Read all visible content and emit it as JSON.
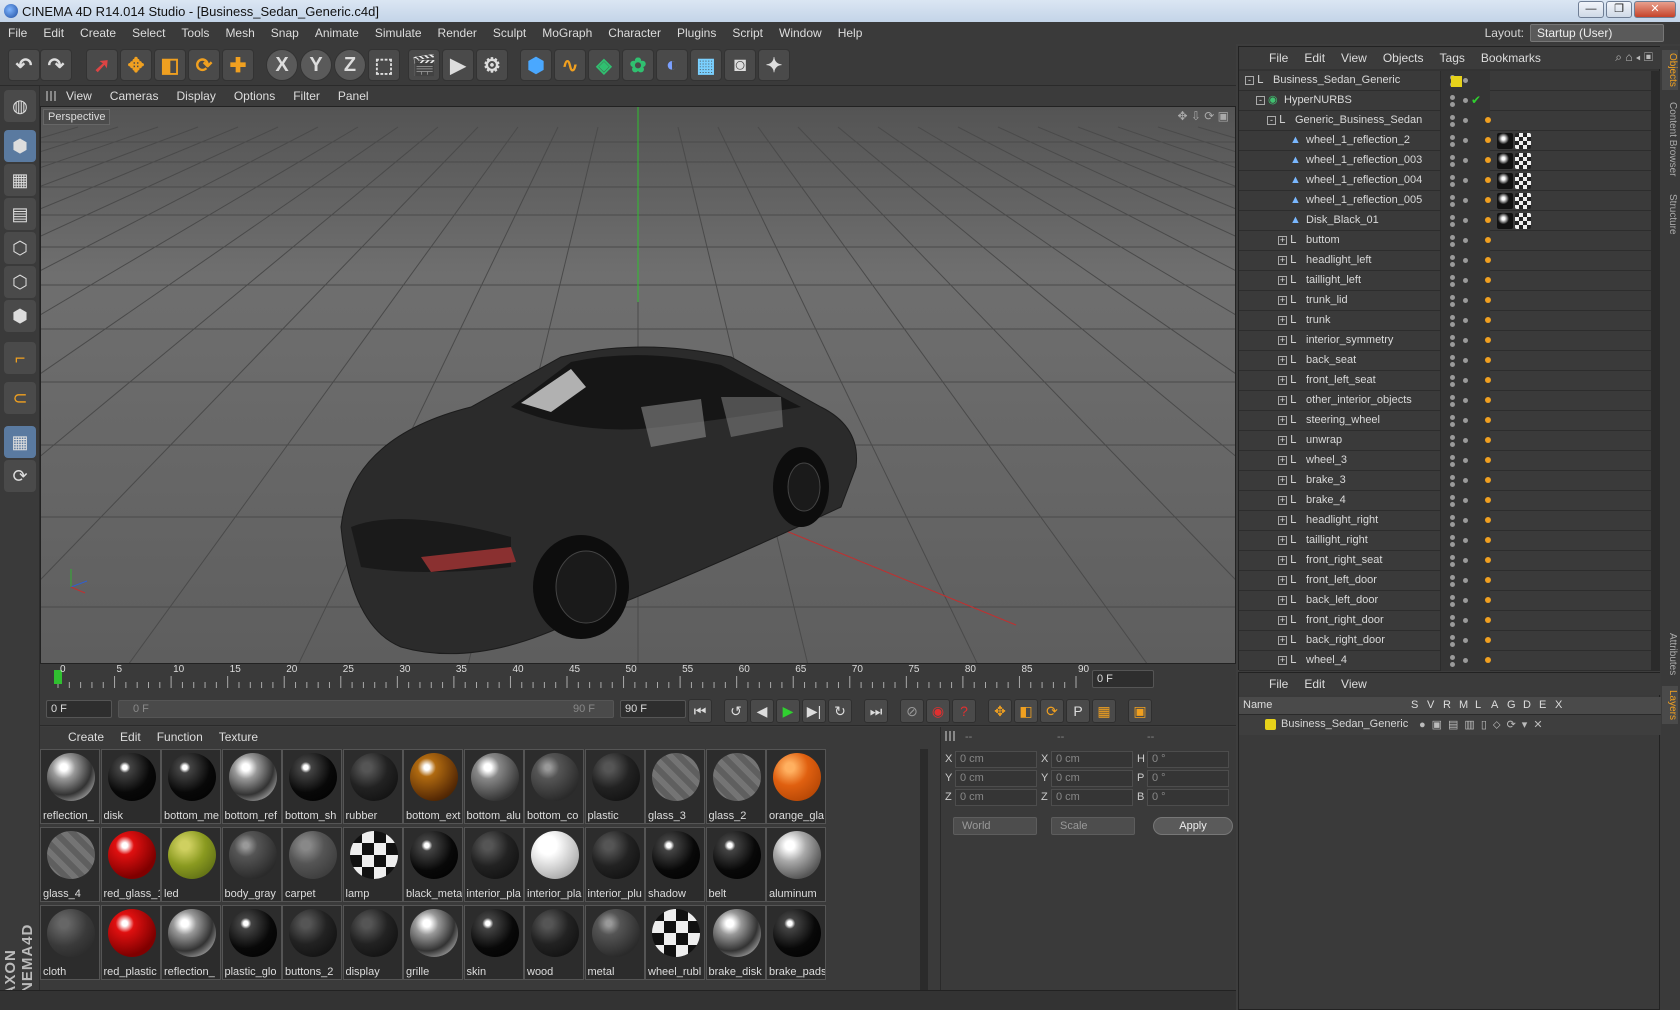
{
  "window": {
    "title": "CINEMA 4D R14.014 Studio - [Business_Sedan_Generic.c4d]",
    "minimize": "—",
    "maximize": "❐",
    "close": "✕"
  },
  "menu": [
    "File",
    "Edit",
    "Create",
    "Select",
    "Tools",
    "Mesh",
    "Snap",
    "Animate",
    "Simulate",
    "Render",
    "Sculpt",
    "MoGraph",
    "Character",
    "Plugins",
    "Script",
    "Window",
    "Help"
  ],
  "layout": {
    "label": "Layout:",
    "value": "Startup (User)"
  },
  "toolbar_icons": [
    "undo-icon",
    "redo-icon",
    "live-selection-icon",
    "move-icon",
    "scale-icon",
    "rotate-icon",
    "add-icon",
    "x-axis-icon",
    "y-axis-icon",
    "z-axis-icon",
    "coordinate-system-icon",
    "render-view-icon",
    "render-picture-viewer-icon",
    "render-settings-icon",
    "cube-icon",
    "spline-pen-icon",
    "nurbs-icon",
    "array-icon",
    "deformer-icon",
    "floor-icon",
    "camera-icon",
    "light-icon"
  ],
  "viewport": {
    "menu": [
      "View",
      "Cameras",
      "Display",
      "Options",
      "Filter",
      "Panel"
    ],
    "label": "Perspective"
  },
  "timeline": {
    "ticks": [
      "0",
      "5",
      "10",
      "15",
      "20",
      "25",
      "30",
      "35",
      "40",
      "45",
      "50",
      "55",
      "60",
      "65",
      "70",
      "75",
      "80",
      "85",
      "90"
    ],
    "current_frame": "0 F",
    "start_field": "0 F",
    "range_start": "0 F",
    "range_end": "90 F",
    "end_field": "90 F"
  },
  "materials": {
    "menu": [
      "Create",
      "Edit",
      "Function",
      "Texture"
    ],
    "items": [
      {
        "name": "reflection_",
        "style": "chrome"
      },
      {
        "name": "disk",
        "style": "black"
      },
      {
        "name": "bottom_me",
        "style": "black"
      },
      {
        "name": "bottom_ref",
        "style": "chrome"
      },
      {
        "name": "bottom_sh",
        "style": "black"
      },
      {
        "name": "rubber",
        "style": "dark"
      },
      {
        "name": "bottom_ext",
        "style": "bronze"
      },
      {
        "name": "bottom_alu",
        "style": "gray"
      },
      {
        "name": "bottom_co",
        "style": "darkgray"
      },
      {
        "name": "plastic",
        "style": "dark"
      },
      {
        "name": "glass_3",
        "style": "glass"
      },
      {
        "name": "glass_2",
        "style": "glass"
      },
      {
        "name": "orange_gla",
        "style": "orange"
      },
      {
        "name": "glass_4",
        "style": "glass"
      },
      {
        "name": "red_glass_1",
        "style": "red"
      },
      {
        "name": "led",
        "style": "olive"
      },
      {
        "name": "body_gray",
        "style": "darkgray"
      },
      {
        "name": "carpet",
        "style": "midgray"
      },
      {
        "name": "lamp",
        "style": "checker"
      },
      {
        "name": "black_meta",
        "style": "black"
      },
      {
        "name": "interior_pla",
        "style": "dark"
      },
      {
        "name": "interior_pla",
        "style": "white"
      },
      {
        "name": "interior_plu",
        "style": "dark"
      },
      {
        "name": "shadow",
        "style": "black"
      },
      {
        "name": "belt",
        "style": "black"
      },
      {
        "name": "aluminum",
        "style": "silver"
      },
      {
        "name": "cloth",
        "style": "cloth"
      },
      {
        "name": "red_plastic",
        "style": "red"
      },
      {
        "name": "reflection_",
        "style": "chrome"
      },
      {
        "name": "plastic_glo",
        "style": "black"
      },
      {
        "name": "buttons_2",
        "style": "dark"
      },
      {
        "name": "display",
        "style": "dark"
      },
      {
        "name": "grille",
        "style": "chrome"
      },
      {
        "name": "skin",
        "style": "black"
      },
      {
        "name": "wood",
        "style": "dark"
      },
      {
        "name": "metal",
        "style": "darkgray"
      },
      {
        "name": "wheel_rubl",
        "style": "checker"
      },
      {
        "name": "brake_disk",
        "style": "chrome"
      },
      {
        "name": "brake_pads",
        "style": "black"
      }
    ]
  },
  "coords": {
    "headers": [
      "--",
      "--",
      "--"
    ],
    "rows": [
      {
        "a": "X",
        "av": "0 cm",
        "b": "X",
        "bv": "0 cm",
        "c": "H",
        "cv": "0 °"
      },
      {
        "a": "Y",
        "av": "0 cm",
        "b": "Y",
        "bv": "0 cm",
        "c": "P",
        "cv": "0 °"
      },
      {
        "a": "Z",
        "av": "0 cm",
        "b": "Z",
        "bv": "0 cm",
        "c": "B",
        "cv": "0 °"
      }
    ],
    "mode": "World",
    "size_mode": "Scale",
    "apply": "Apply"
  },
  "objects": {
    "menu": [
      "File",
      "Edit",
      "View",
      "Objects",
      "Tags",
      "Bookmarks"
    ],
    "rows": [
      {
        "name": "Business_Sedan_Generic",
        "depth": 0,
        "icon": "null-icon",
        "expand": "-",
        "tags": []
      },
      {
        "name": "HyperNURBS",
        "depth": 1,
        "icon": "hypernurbs-icon",
        "expand": "-",
        "tags": []
      },
      {
        "name": "Generic_Business_Sedan",
        "depth": 2,
        "icon": "null-icon",
        "expand": "-",
        "tags": []
      },
      {
        "name": "wheel_1_reflection_2",
        "depth": 3,
        "icon": "polygon-icon",
        "expand": "",
        "tags": [
          "mat",
          "checker"
        ]
      },
      {
        "name": "wheel_1_reflection_003",
        "depth": 3,
        "icon": "polygon-icon",
        "expand": "",
        "tags": [
          "mat",
          "checker"
        ]
      },
      {
        "name": "wheel_1_reflection_004",
        "depth": 3,
        "icon": "polygon-icon",
        "expand": "",
        "tags": [
          "mat",
          "checker"
        ]
      },
      {
        "name": "wheel_1_reflection_005",
        "depth": 3,
        "icon": "polygon-icon",
        "expand": "",
        "tags": [
          "mat",
          "checker"
        ]
      },
      {
        "name": "Disk_Black_01",
        "depth": 3,
        "icon": "polygon-icon",
        "expand": "",
        "tags": [
          "mat",
          "checker"
        ]
      },
      {
        "name": "buttom",
        "depth": 3,
        "icon": "null-icon",
        "expand": "+",
        "tags": []
      },
      {
        "name": "headlight_left",
        "depth": 3,
        "icon": "null-icon",
        "expand": "+",
        "tags": []
      },
      {
        "name": "taillight_left",
        "depth": 3,
        "icon": "null-icon",
        "expand": "+",
        "tags": []
      },
      {
        "name": "trunk_lid",
        "depth": 3,
        "icon": "null-icon",
        "expand": "+",
        "tags": []
      },
      {
        "name": "trunk",
        "depth": 3,
        "icon": "null-icon",
        "expand": "+",
        "tags": []
      },
      {
        "name": "interior_symmetry",
        "depth": 3,
        "icon": "null-icon",
        "expand": "+",
        "tags": []
      },
      {
        "name": "back_seat",
        "depth": 3,
        "icon": "null-icon",
        "expand": "+",
        "tags": []
      },
      {
        "name": "front_left_seat",
        "depth": 3,
        "icon": "null-icon",
        "expand": "+",
        "tags": []
      },
      {
        "name": "other_interior_objects",
        "depth": 3,
        "icon": "null-icon",
        "expand": "+",
        "tags": []
      },
      {
        "name": "steering_wheel",
        "depth": 3,
        "icon": "null-icon",
        "expand": "+",
        "tags": []
      },
      {
        "name": "unwrap",
        "depth": 3,
        "icon": "null-icon",
        "expand": "+",
        "tags": []
      },
      {
        "name": "wheel_3",
        "depth": 3,
        "icon": "null-icon",
        "expand": "+",
        "tags": []
      },
      {
        "name": "brake_3",
        "depth": 3,
        "icon": "null-icon",
        "expand": "+",
        "tags": []
      },
      {
        "name": "brake_4",
        "depth": 3,
        "icon": "null-icon",
        "expand": "+",
        "tags": []
      },
      {
        "name": "headlight_right",
        "depth": 3,
        "icon": "null-icon",
        "expand": "+",
        "tags": []
      },
      {
        "name": "taillight_right",
        "depth": 3,
        "icon": "null-icon",
        "expand": "+",
        "tags": []
      },
      {
        "name": "front_right_seat",
        "depth": 3,
        "icon": "null-icon",
        "expand": "+",
        "tags": []
      },
      {
        "name": "front_left_door",
        "depth": 3,
        "icon": "null-icon",
        "expand": "+",
        "tags": []
      },
      {
        "name": "back_left_door",
        "depth": 3,
        "icon": "null-icon",
        "expand": "+",
        "tags": []
      },
      {
        "name": "front_right_door",
        "depth": 3,
        "icon": "null-icon",
        "expand": "+",
        "tags": []
      },
      {
        "name": "back_right_door",
        "depth": 3,
        "icon": "null-icon",
        "expand": "+",
        "tags": []
      },
      {
        "name": "wheel_4",
        "depth": 3,
        "icon": "null-icon",
        "expand": "+",
        "tags": []
      }
    ]
  },
  "side_tabs": [
    "Objects",
    "Content Browser",
    "Structure",
    "Attributes",
    "Layers"
  ],
  "layers": {
    "menu": [
      "File",
      "Edit",
      "View"
    ],
    "columns": [
      "Name",
      "S",
      "V",
      "R",
      "M",
      "L",
      "A",
      "G",
      "D",
      "E",
      "X"
    ],
    "row": {
      "name": "Business_Sedan_Generic",
      "color": "#e6d21a"
    }
  },
  "colors": {
    "accent": "#f0a020",
    "axis_x": "#c03030",
    "axis_y": "#30b030",
    "axis_z": "#3060d0"
  }
}
